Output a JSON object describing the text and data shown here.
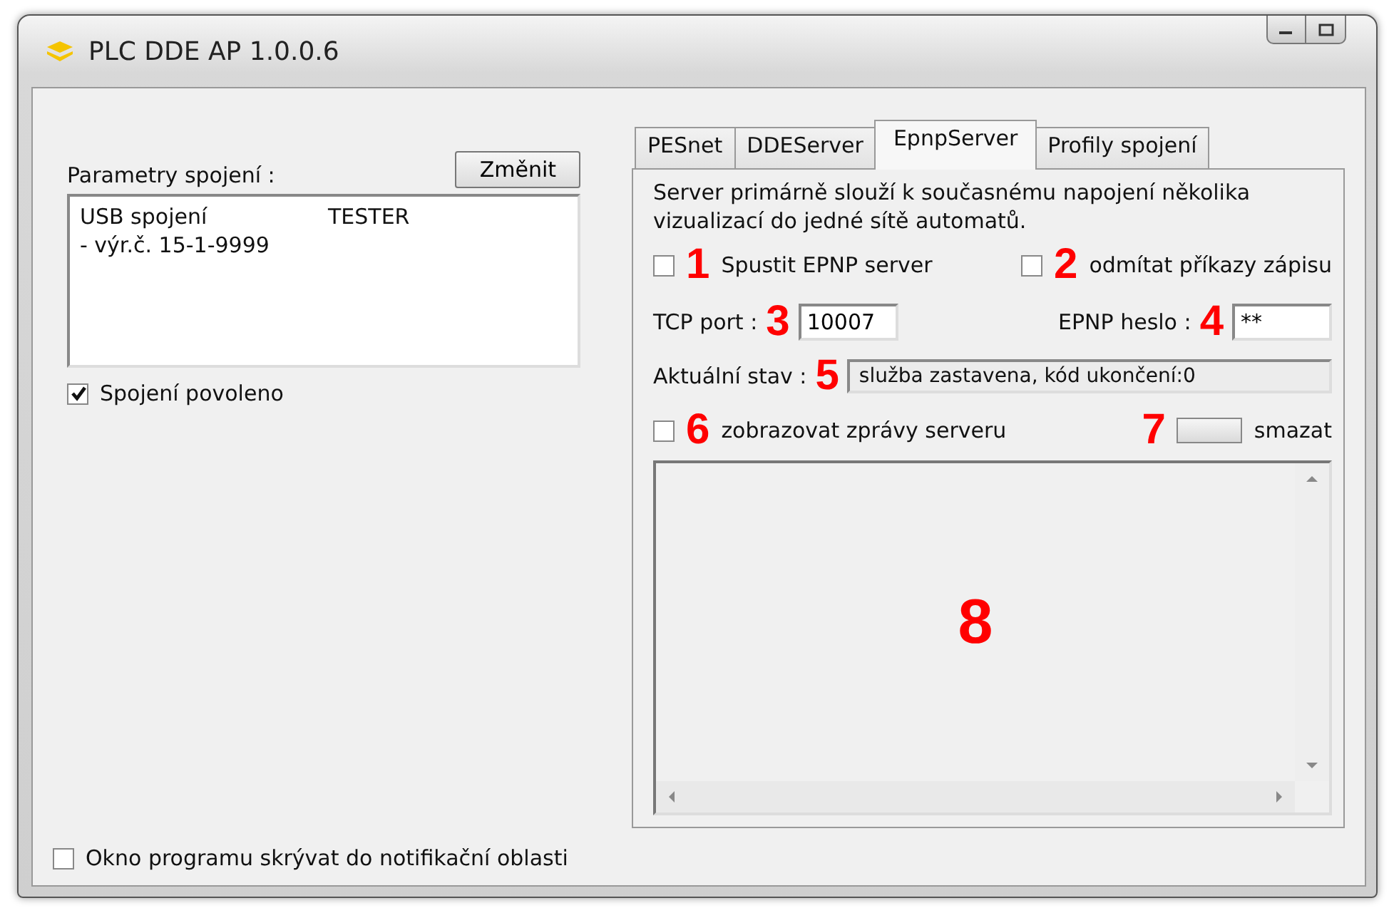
{
  "window": {
    "title": "PLC DDE AP 1.0.0.6"
  },
  "connection": {
    "label": "Parametry spojení :",
    "change_button": "Změnit",
    "lines": [
      {
        "text": "USB spojení",
        "tag": "TESTER"
      },
      {
        "text": "- výr.č. 15-1-9999"
      }
    ],
    "enabled": {
      "label": "Spojení povoleno",
      "checked": true
    }
  },
  "tabs": [
    {
      "label": "PESnet",
      "selected": false
    },
    {
      "label": "DDEServer",
      "selected": false
    },
    {
      "label": "EpnpServer",
      "selected": true
    },
    {
      "label": "Profily spojení",
      "selected": false
    }
  ],
  "server": {
    "description": "Server primárně slouží k současnému napojení několika vizualizací do jedné sítě automatů.",
    "options": [
      {
        "callout": "1",
        "label": "Spustit EPNP server",
        "checked": false
      },
      {
        "callout": "2",
        "label": "odmítat příkazy zápisu",
        "checked": false
      }
    ],
    "port": {
      "label": "TCP port :",
      "callout": "3",
      "value": "10007"
    },
    "password": {
      "label": "EPNP heslo :",
      "callout": "4",
      "value": "**"
    },
    "status": {
      "label": "Aktuální stav :",
      "callout": "5",
      "value": "služba zastavena, kód ukončení:0"
    },
    "show_messages": {
      "callout": "6",
      "label": "zobrazovat zprávy serveru",
      "checked": false
    },
    "clear": {
      "callout": "7",
      "label": "smazat"
    },
    "log": {
      "callout": "8"
    }
  },
  "footer": {
    "label": "Okno programu skrývat do notifikační oblasti",
    "checked": false
  }
}
